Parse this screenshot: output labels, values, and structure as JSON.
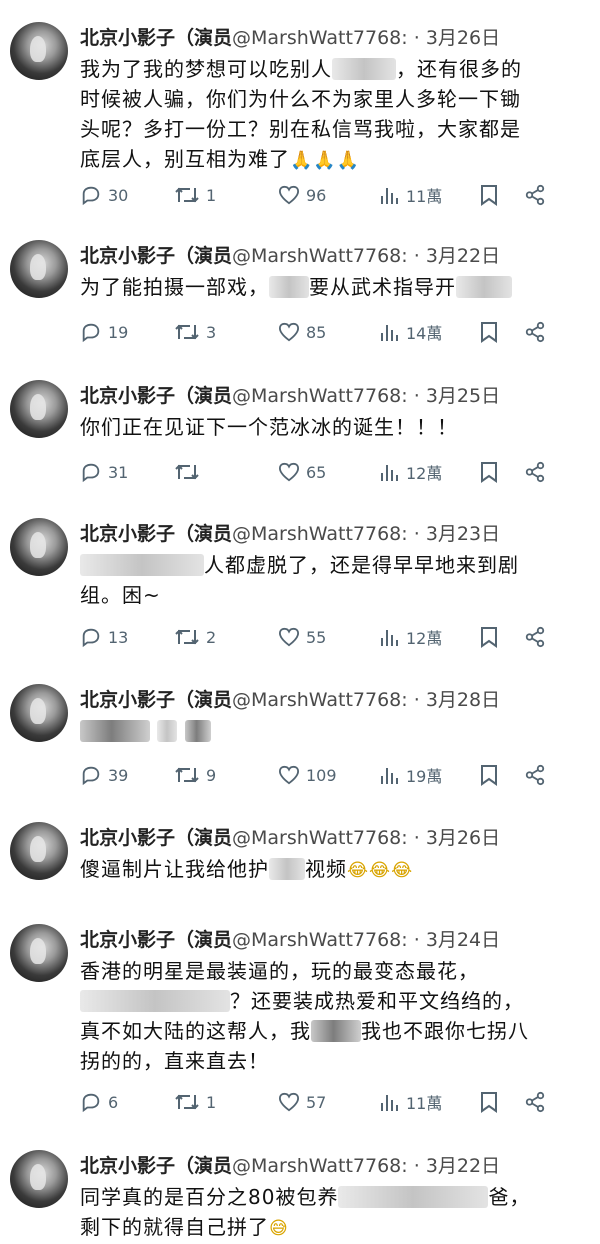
{
  "author": "北京小影子（演员",
  "handle": "@MarshWatt7768:",
  "separator": "·",
  "posts": [
    {
      "date": "3月26日",
      "text": [
        "我为了我的梦想可以吃别人",
        "，还有很多的时候被人骗，你们为什么不为家里人多轮一下锄头呢？多打一份工？别在私信骂我啦，大家都是底层人，别互相为难了"
      ],
      "emoji": "🙏🙏🙏",
      "stats": {
        "replies": "30",
        "reposts": "1",
        "likes": "96",
        "views": "11萬"
      }
    },
    {
      "date": "3月22日",
      "text": [
        "为了能拍摄一部戏，",
        "要从武术指导开"
      ],
      "stats": {
        "replies": "19",
        "reposts": "3",
        "likes": "85",
        "views": "14萬"
      }
    },
    {
      "date": "3月25日",
      "text": [
        "你们正在见证下一个范冰冰的诞生！！！"
      ],
      "stats": {
        "replies": "31",
        "reposts": "",
        "likes": "65",
        "views": "12萬"
      }
    },
    {
      "date": "3月23日",
      "text": [
        "人都虚脱了，还是得早早地来到剧组。困~"
      ],
      "stats": {
        "replies": "13",
        "reposts": "2",
        "likes": "55",
        "views": "12萬"
      }
    },
    {
      "date": "3月28日",
      "text": [],
      "stats": {
        "replies": "39",
        "reposts": "9",
        "likes": "109",
        "views": "19萬"
      }
    },
    {
      "date": "3月26日",
      "text": [
        "傻逼制片让我给他护",
        "视频"
      ],
      "emoji": "😂😂😂"
    },
    {
      "date": "3月24日",
      "text": [
        "香港的明星是最装逼的，玩的最变态最花，",
        "？还要装成热爱和平文绉绉的，真不如大陆的这帮人，我",
        "我也不跟你七拐八拐的的，直来直去！"
      ],
      "stats": {
        "replies": "6",
        "reposts": "1",
        "likes": "57",
        "views": "11萬"
      }
    },
    {
      "date": "3月22日",
      "text": [
        "同学真的是百分之80被包养",
        "爸，剩下的就得自己拼了"
      ],
      "emoji": "😅"
    }
  ],
  "icons": [
    "reply-icon",
    "repost-icon",
    "like-icon",
    "views-icon",
    "bookmark-icon",
    "share-icon"
  ]
}
